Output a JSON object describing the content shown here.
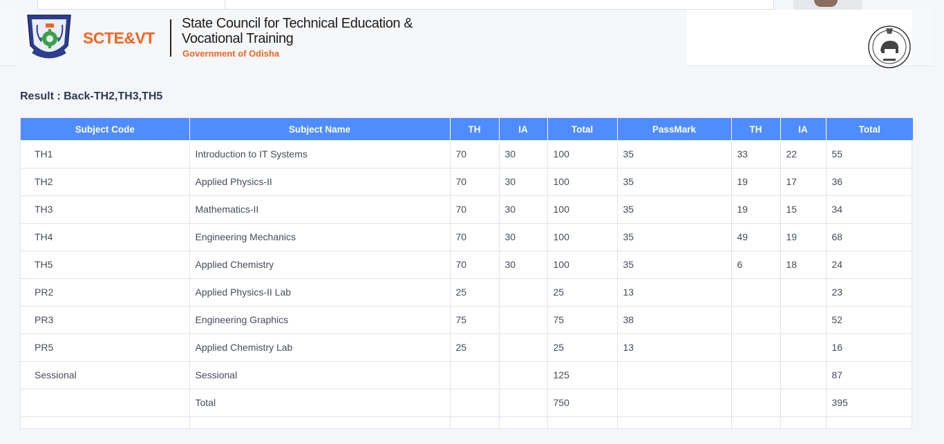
{
  "header": {
    "brand": "SCTE&VT",
    "title_line1": "State Council for Technical Education &",
    "title_line2": "Vocational Training",
    "subtitle": "Government of Odisha"
  },
  "result": {
    "heading": "Result : Back-TH2,TH3,TH5"
  },
  "table": {
    "columns": [
      "Subject Code",
      "Subject Name",
      "TH",
      "IA",
      "Total",
      "PassMark",
      "TH",
      "IA",
      "Total"
    ],
    "rows": [
      [
        "TH1",
        "Introduction to IT Systems",
        "70",
        "30",
        "100",
        "35",
        "33",
        "22",
        "55"
      ],
      [
        "TH2",
        "Applied Physics-II",
        "70",
        "30",
        "100",
        "35",
        "19",
        "17",
        "36"
      ],
      [
        "TH3",
        "Mathematics-II",
        "70",
        "30",
        "100",
        "35",
        "19",
        "15",
        "34"
      ],
      [
        "TH4",
        "Engineering Mechanics",
        "70",
        "30",
        "100",
        "35",
        "49",
        "19",
        "68"
      ],
      [
        "TH5",
        "Applied Chemistry",
        "70",
        "30",
        "100",
        "35",
        "6",
        "18",
        "24"
      ],
      [
        "PR2",
        "Applied Physics-II Lab",
        "25",
        "",
        "25",
        "13",
        "",
        "",
        "23"
      ],
      [
        "PR3",
        "Engineering Graphics",
        "75",
        "",
        "75",
        "38",
        "",
        "",
        "52"
      ],
      [
        "PR5",
        "Applied Chemistry Lab",
        "25",
        "",
        "25",
        "13",
        "",
        "",
        "16"
      ],
      [
        "Sessional",
        "Sessional",
        "",
        "",
        "125",
        "",
        "",
        "",
        "87"
      ],
      [
        "",
        "Total",
        "",
        "",
        "750",
        "",
        "",
        "",
        "395"
      ]
    ]
  },
  "colors": {
    "header_blue": "#4f8cff",
    "brand_orange": "#f26522"
  }
}
